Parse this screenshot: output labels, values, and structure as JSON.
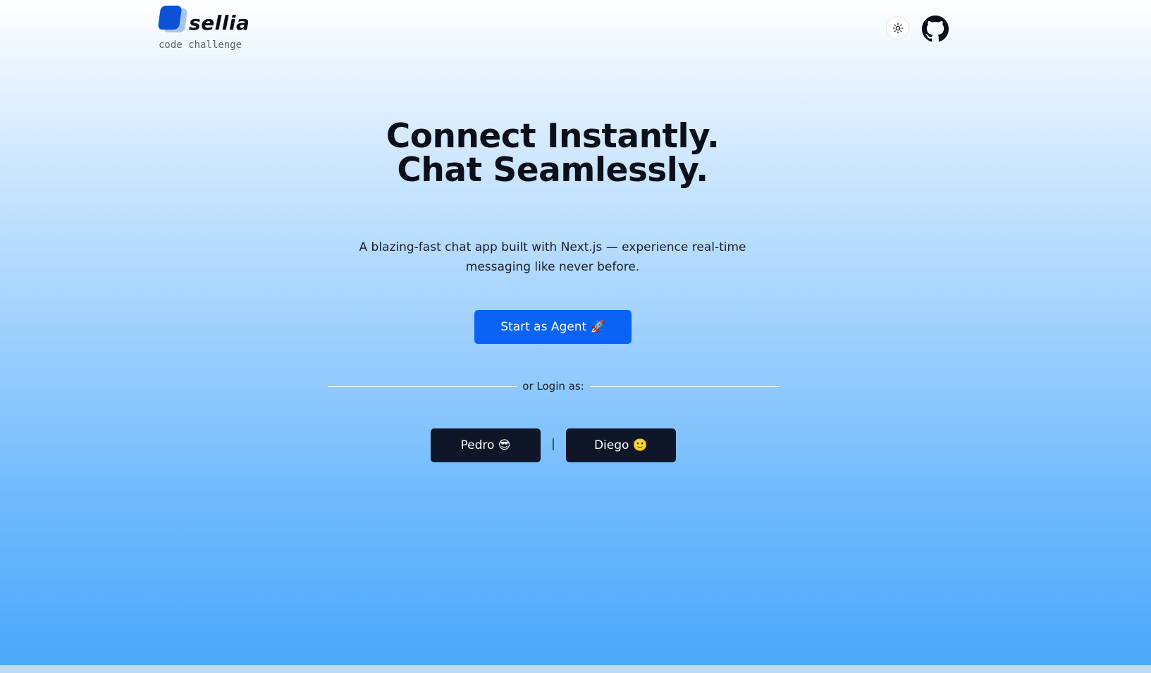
{
  "header": {
    "brand_name": "sellia",
    "brand_subtitle": "code challenge",
    "theme_toggle_icon": "sun-icon",
    "github_icon": "github-icon"
  },
  "hero": {
    "title_line_1": "Connect Instantly.",
    "title_line_2": "Chat Seamlessly.",
    "description": "A blazing-fast chat app built with Next.js — experience real-time messaging like never before.",
    "primary_button_label": "Start as Agent 🚀",
    "divider_text": "or Login as:",
    "login_buttons": [
      {
        "label": "Pedro 😎"
      },
      {
        "label": "Diego 🙂"
      }
    ],
    "separator": "|"
  },
  "colors": {
    "primary": "#0a63f5",
    "dark_button": "#0e1627",
    "logo_blue": "#0b52d6",
    "gradient_bottom": "#4ba8f9"
  }
}
